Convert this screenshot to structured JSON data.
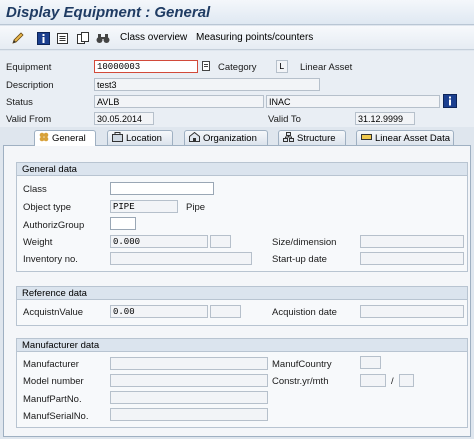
{
  "window": {
    "title": "Display Equipment : General"
  },
  "toolbar": {
    "icons": [
      "pencil-icon",
      "info-icon",
      "document-icon",
      "copy-icon",
      "binoculars-icon"
    ],
    "class_overview": "Class overview",
    "measuring_points": "Measuring points/counters"
  },
  "header": {
    "equipment_label": "Equipment",
    "equipment_value": "10000003",
    "category_label": "Category",
    "category_value": "L",
    "category_text": "Linear Asset",
    "description_label": "Description",
    "description_value": "test3",
    "status_label": "Status",
    "status_value": "AVLB",
    "status_value2": "INAC",
    "valid_from_label": "Valid From",
    "valid_from_value": "30.05.2014",
    "valid_to_label": "Valid To",
    "valid_to_value": "31.12.9999"
  },
  "tabs": [
    {
      "label": "General",
      "icon": "general-icon",
      "active": true
    },
    {
      "label": "Location",
      "icon": "location-icon"
    },
    {
      "label": "Organization",
      "icon": "organization-icon"
    },
    {
      "label": "Structure",
      "icon": "structure-icon"
    },
    {
      "label": "Linear Asset Data",
      "icon": "linear-asset-icon"
    }
  ],
  "general_data": {
    "title": "General data",
    "class_label": "Class",
    "object_type_label": "Object type",
    "object_type_value": "PIPE",
    "object_type_text": "Pipe",
    "authoriz_group_label": "AuthorizGroup",
    "weight_label": "Weight",
    "weight_value": "0.000",
    "size_dimension_label": "Size/dimension",
    "inventory_label": "Inventory no.",
    "startup_label": "Start-up date"
  },
  "reference_data": {
    "title": "Reference data",
    "acquistn_value_label": "AcquistnValue",
    "acquistn_value": "0.00",
    "acquistion_date_label": "Acquistion date"
  },
  "manufacturer_data": {
    "title": "Manufacturer data",
    "manufacturer_label": "Manufacturer",
    "manuf_country_label": "ManufCountry",
    "model_number_label": "Model number",
    "constr_label": "Constr.yr/mth",
    "constr_sep": "/",
    "part_no_label": "ManufPartNo.",
    "serial_no_label": "ManufSerialNo."
  }
}
